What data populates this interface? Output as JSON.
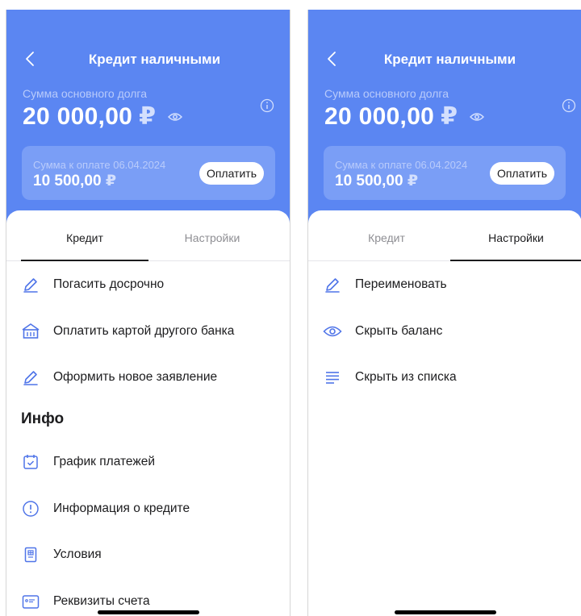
{
  "colors": {
    "header": "#5b86f2",
    "card": "#7a9ef6",
    "accent_icon": "#4f74e8"
  },
  "left": {
    "title": "Кредит наличными",
    "debt_caption": "Сумма основного долга",
    "debt_amount": "20 000,00",
    "currency": "₽",
    "pay_caption": "Сумма к оплате  06.04.2024",
    "pay_amount": "10 500,00",
    "pay_button": "Оплатить",
    "tabs": [
      {
        "label": "Кредит",
        "active": true
      },
      {
        "label": "Настройки",
        "active": false
      }
    ],
    "actions": [
      {
        "label": "Погасить досрочно",
        "icon": "pencil-icon"
      },
      {
        "label": "Оплатить картой другого банка",
        "icon": "bank-icon"
      },
      {
        "label": "Оформить новое заявление",
        "icon": "pencil-icon"
      }
    ],
    "info_title": "Инфо",
    "info_items": [
      {
        "label": "График платежей",
        "icon": "calendar-icon"
      },
      {
        "label": "Информация о кредите",
        "icon": "info-circle-icon"
      },
      {
        "label": "Условия",
        "icon": "document-icon"
      },
      {
        "label": "Реквизиты счета",
        "icon": "id-card-icon"
      }
    ]
  },
  "right": {
    "title": "Кредит наличными",
    "debt_caption": "Сумма основного долга",
    "debt_amount": "20 000,00",
    "currency": "₽",
    "pay_caption": "Сумма к оплате  06.04.2024",
    "pay_amount": "10 500,00",
    "pay_button": "Оплатить",
    "tabs": [
      {
        "label": "Кредит",
        "active": false
      },
      {
        "label": "Настройки",
        "active": true
      }
    ],
    "settings_items": [
      {
        "label": "Переименовать",
        "icon": "pencil-icon"
      },
      {
        "label": "Скрыть баланс",
        "icon": "eye-icon"
      },
      {
        "label": "Скрыть из списка",
        "icon": "list-icon"
      }
    ]
  }
}
